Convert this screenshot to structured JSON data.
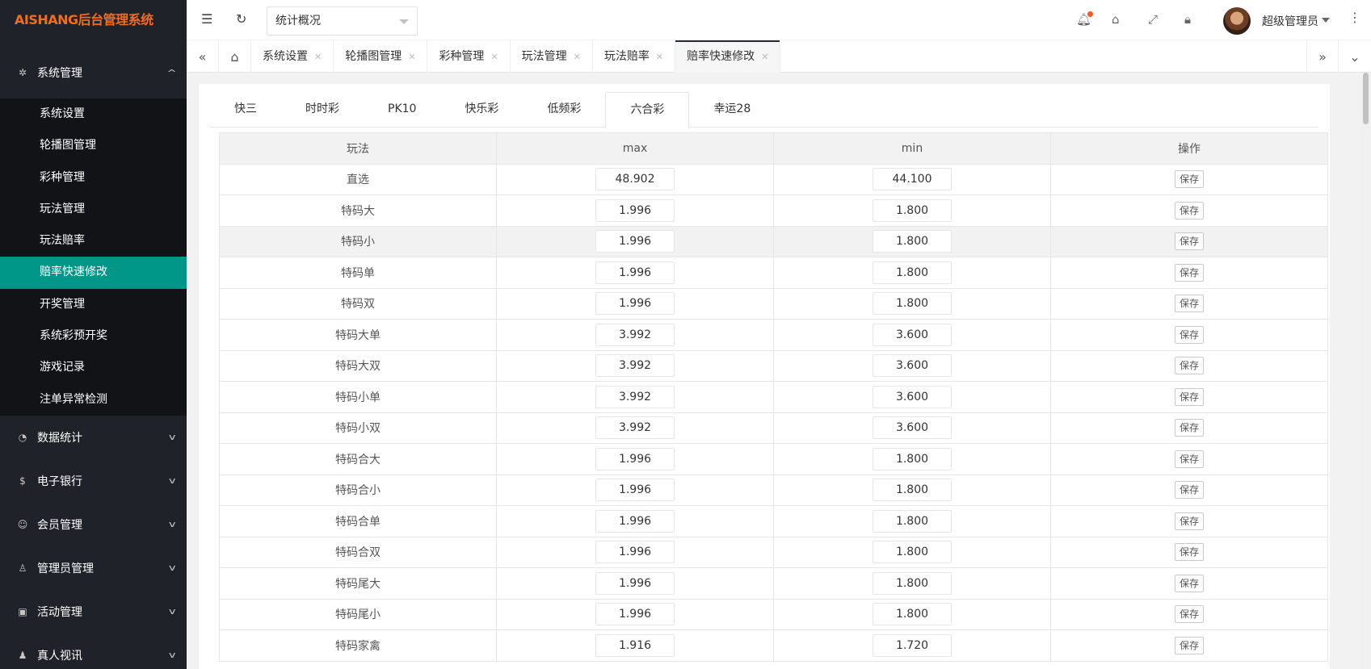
{
  "sidebar": {
    "logo": "AISHANG后台管理系统",
    "groups": [
      {
        "label": "系统管理",
        "icon": "gear-icon",
        "open": true,
        "items": [
          "系统设置",
          "轮播图管理",
          "彩种管理",
          "玩法管理",
          "玩法赔率",
          "赔率快速修改",
          "开奖管理",
          "系统彩预开奖",
          "游戏记录",
          "注单异常检测"
        ],
        "active": "赔率快速修改"
      },
      {
        "label": "数据统计",
        "icon": "dashboard-icon"
      },
      {
        "label": "电子银行",
        "icon": "dollar-icon"
      },
      {
        "label": "会员管理",
        "icon": "users-icon"
      },
      {
        "label": "管理员管理",
        "icon": "user-icon"
      },
      {
        "label": "活动管理",
        "icon": "gift-icon"
      },
      {
        "label": "真人视讯",
        "icon": "people-icon"
      }
    ]
  },
  "header": {
    "select_value": "统计概况",
    "username": "超级管理员"
  },
  "tabs": [
    {
      "label": "系统设置"
    },
    {
      "label": "轮播图管理"
    },
    {
      "label": "彩种管理"
    },
    {
      "label": "玩法管理"
    },
    {
      "label": "玩法赔率"
    },
    {
      "label": "赔率快速修改",
      "active": true
    }
  ],
  "lottery_tabs": [
    "快三",
    "时时彩",
    "PK10",
    "快乐彩",
    "低频彩",
    "六合彩",
    "幸运28"
  ],
  "lottery_active": "六合彩",
  "table": {
    "columns": [
      "玩法",
      "max",
      "min",
      "操作"
    ],
    "save_label": "保存",
    "rows": [
      {
        "name": "直选",
        "max": "48.902",
        "min": "44.100"
      },
      {
        "name": "特码大",
        "max": "1.996",
        "min": "1.800"
      },
      {
        "name": "特码小",
        "max": "1.996",
        "min": "1.800"
      },
      {
        "name": "特码单",
        "max": "1.996",
        "min": "1.800"
      },
      {
        "name": "特码双",
        "max": "1.996",
        "min": "1.800"
      },
      {
        "name": "特码大单",
        "max": "3.992",
        "min": "3.600"
      },
      {
        "name": "特码大双",
        "max": "3.992",
        "min": "3.600"
      },
      {
        "name": "特码小单",
        "max": "3.992",
        "min": "3.600"
      },
      {
        "name": "特码小双",
        "max": "3.992",
        "min": "3.600"
      },
      {
        "name": "特码合大",
        "max": "1.996",
        "min": "1.800"
      },
      {
        "name": "特码合小",
        "max": "1.996",
        "min": "1.800"
      },
      {
        "name": "特码合单",
        "max": "1.996",
        "min": "1.800"
      },
      {
        "name": "特码合双",
        "max": "1.996",
        "min": "1.800"
      },
      {
        "name": "特码尾大",
        "max": "1.996",
        "min": "1.800"
      },
      {
        "name": "特码尾小",
        "max": "1.996",
        "min": "1.800"
      },
      {
        "name": "特码家禽",
        "max": "1.916",
        "min": "1.720"
      }
    ],
    "highlight_row": 2
  },
  "colors": {
    "accent": "#009688",
    "logo": "#f56c1a",
    "sidebar_bg": "#20222a",
    "notify_dot": "#ff5722"
  }
}
